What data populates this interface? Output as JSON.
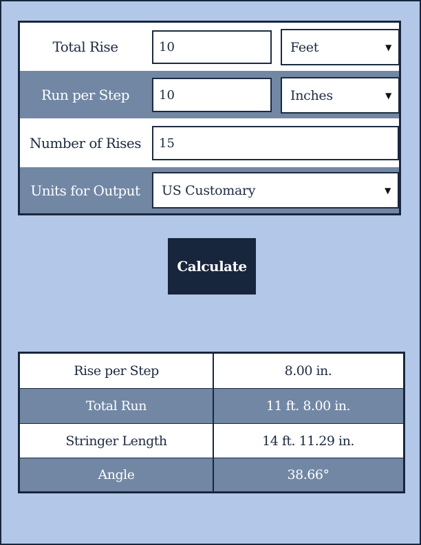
{
  "form": {
    "rows": [
      {
        "label": "Total Rise",
        "value": "10",
        "unit": "Feet"
      },
      {
        "label": "Run per Step",
        "value": "10",
        "unit": "Inches"
      },
      {
        "label": "Number of Rises",
        "value": "15"
      },
      {
        "label": "Units for Output",
        "select": "US Customary"
      }
    ],
    "caret_glyph": "▼"
  },
  "calculate_label": "Calculate",
  "results": [
    {
      "label": "Rise per Step",
      "value": "8.00 in."
    },
    {
      "label": "Total Run",
      "value": "11 ft. 8.00 in."
    },
    {
      "label": "Stringer Length",
      "value": "14 ft. 11.29 in."
    },
    {
      "label": "Angle",
      "value": "38.66°"
    }
  ],
  "colors": {
    "background": "#b3c8e8",
    "navy": "#18263d",
    "row_dark": "#7187a4",
    "row_light": "#ffffff"
  }
}
